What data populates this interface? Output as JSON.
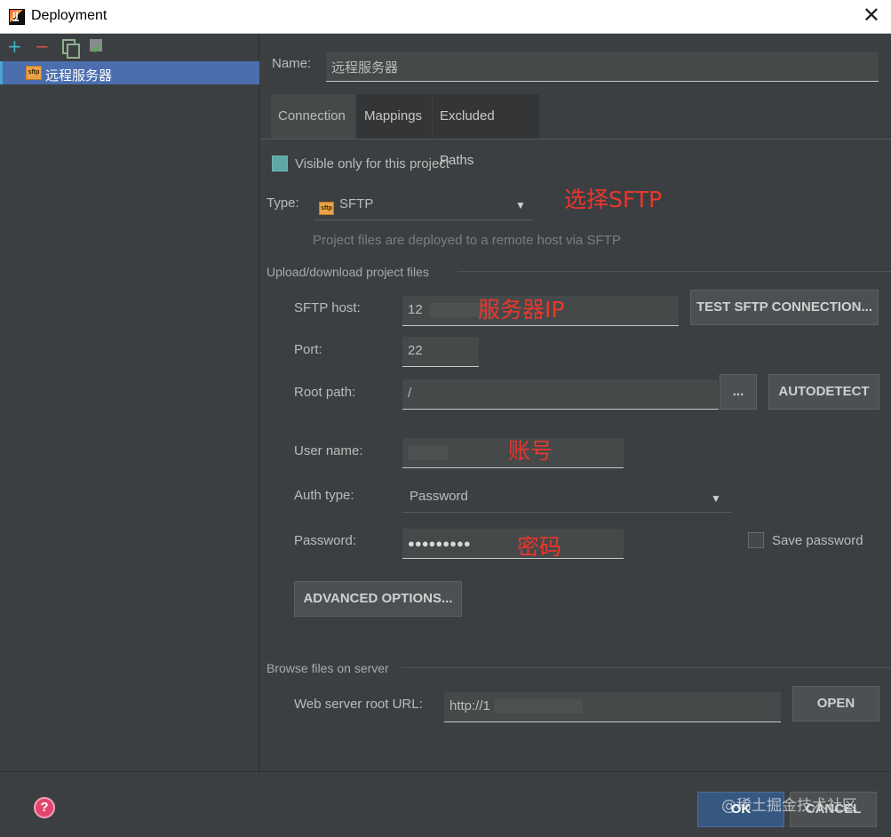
{
  "window": {
    "title": "Deployment",
    "close_glyph": "✕"
  },
  "app_icon_text": "IJ",
  "toolbar": {
    "add": "+",
    "remove": "−"
  },
  "tree": {
    "server_name": "远程服务器",
    "icon_text": "sftp"
  },
  "form": {
    "name_label": "Name:",
    "name_value": "远程服务器",
    "tabs": [
      "Connection",
      "Mappings",
      "Excluded Paths"
    ],
    "visible_only_label": "Visible only for this project",
    "type_label": "Type:",
    "type_value": "SFTP",
    "type_hint": "Project files are deployed to a remote host via SFTP",
    "upload_section": "Upload/download project files",
    "host_label": "SFTP host:",
    "host_value": "12",
    "test_button": "TEST SFTP CONNECTION...",
    "port_label": "Port:",
    "port_value": "22",
    "root_label": "Root path:",
    "root_value": "/",
    "browse_button": "...",
    "autodetect_button": "AUTODETECT",
    "user_label": "User name:",
    "user_value": "",
    "auth_label": "Auth type:",
    "auth_value": "Password",
    "password_label": "Password:",
    "password_value": "●●●●●●●●●",
    "save_password_label": "Save password",
    "advanced_button": "ADVANCED OPTIONS...",
    "browse_section": "Browse files on server",
    "web_url_label": "Web server root URL:",
    "web_url_value": "http://1",
    "open_button": "OPEN"
  },
  "annotations": {
    "sftp": "选择SFTP",
    "ip": "服务器IP",
    "account": "账号",
    "password": "密码"
  },
  "footer": {
    "ok": "OK",
    "cancel": "CANCEL",
    "help": "?",
    "watermark": "@稀土掘金技术社区"
  },
  "colors": {
    "selection": "#4b6eaf",
    "annotation": "#e8372d",
    "ok": "#365880"
  }
}
